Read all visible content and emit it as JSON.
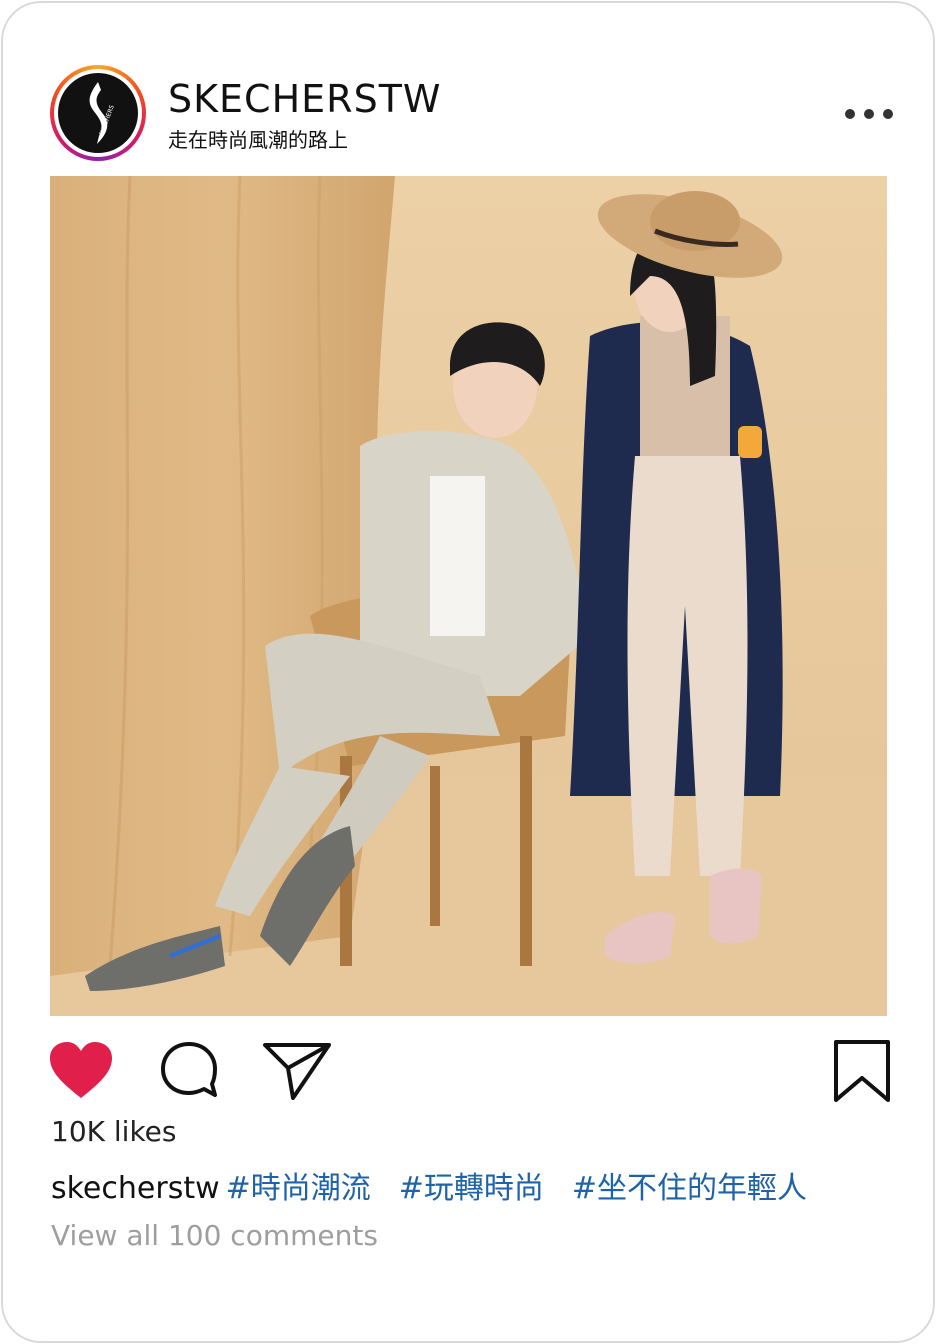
{
  "header": {
    "username": "SKECHERSTW",
    "tagline": "走在時尚風潮的路上",
    "avatar_brand_text": "SKECHERS"
  },
  "post": {
    "likes": "10K likes",
    "caption_user": "skecherstw",
    "hashtags": [
      "#時尚潮流",
      "#玩轉時尚",
      "#坐不住的年輕人"
    ],
    "view_comments": "View all 100 comments"
  },
  "icons": {
    "like": "heart-icon",
    "comment": "comment-bubble-icon",
    "share": "paper-plane-icon",
    "save": "bookmark-icon",
    "more": "ellipsis-icon"
  },
  "colors": {
    "heart": "#e0204a",
    "hashtag": "#1e63a8",
    "muted": "#9e9e9e"
  }
}
